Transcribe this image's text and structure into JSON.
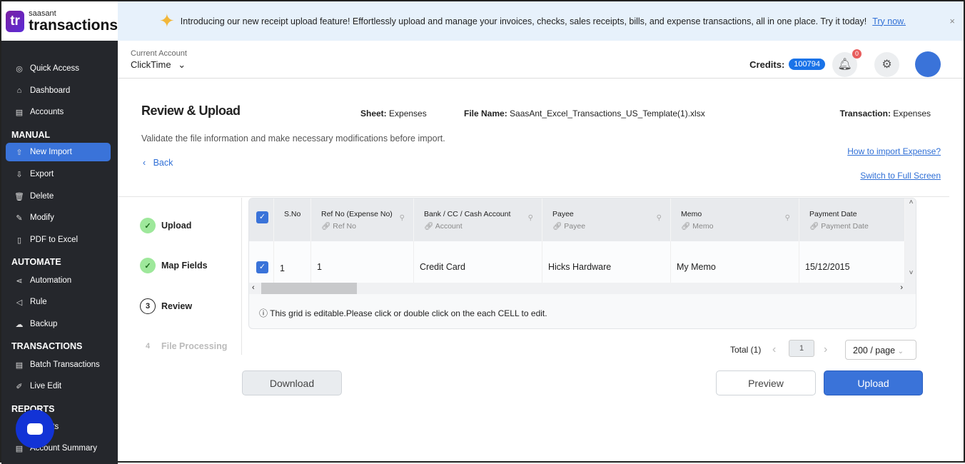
{
  "logo": {
    "small": "saasant",
    "big": "transactions",
    "mark": "tr"
  },
  "banner": {
    "text": "Introducing our new receipt upload feature! Effortlessly upload and manage your invoices, checks, sales receipts, bills, and expense transactions, all in one place. Try it today!",
    "link": "Try now.",
    "close": "×"
  },
  "sidebar": {
    "items": [
      {
        "label": "Quick Access",
        "icon": "target-icon"
      },
      {
        "label": "Dashboard",
        "icon": "home-icon"
      },
      {
        "label": "Accounts",
        "icon": "clipboard-icon"
      },
      {
        "label": "New Import",
        "icon": "upload-cloud-icon",
        "active": true
      },
      {
        "label": "Export",
        "icon": "download-cloud-icon"
      },
      {
        "label": "Delete",
        "icon": "trash-icon"
      },
      {
        "label": "Modify",
        "icon": "edit-file-icon"
      },
      {
        "label": "PDF to Excel",
        "icon": "pdf-icon"
      },
      {
        "label": "Automation",
        "icon": "share-icon"
      },
      {
        "label": "Rule",
        "icon": "megaphone-icon"
      },
      {
        "label": "Backup",
        "icon": "cloud-icon"
      },
      {
        "label": "Batch Transactions",
        "icon": "document-icon"
      },
      {
        "label": "Live Edit",
        "icon": "pencil-icon"
      },
      {
        "label": "Reports",
        "icon": "report-icon"
      },
      {
        "label": "Account Summary",
        "icon": "clipboard-icon"
      }
    ],
    "sections": [
      "MANUAL",
      "AUTOMATE",
      "TRANSACTIONS",
      "REPORTS"
    ]
  },
  "header": {
    "current_account_label": "Current Account",
    "account": "ClickTime",
    "credits_label": "Credits:",
    "credits": "100794",
    "notifications": "0"
  },
  "page": {
    "title": "Review & Upload",
    "sheet_label": "Sheet:",
    "sheet": "Expenses",
    "file_label": "File Name:",
    "file": "SaasAnt_Excel_Transactions_US_Template(1).xlsx",
    "txn_label": "Transaction:",
    "txn": "Expenses",
    "subtitle": "Validate the file information and make necessary modifications before import.",
    "back": "Back",
    "how_to": "How to import Expense?",
    "full_screen": "Switch to Full Screen"
  },
  "steps": [
    {
      "label": "Upload",
      "state": "done"
    },
    {
      "label": "Map Fields",
      "state": "done"
    },
    {
      "label": "Review",
      "num": "3",
      "state": "current"
    },
    {
      "label": "File Processing",
      "num": "4",
      "state": "future"
    }
  ],
  "grid": {
    "columns": [
      {
        "title": "S.No"
      },
      {
        "title": "Ref No (Expense No)",
        "mapped": "Ref No"
      },
      {
        "title": "Bank / CC / Cash Account",
        "mapped": "Account"
      },
      {
        "title": "Payee",
        "mapped": "Payee"
      },
      {
        "title": "Memo",
        "mapped": "Memo"
      },
      {
        "title": "Payment Date",
        "mapped": "Payment Date"
      }
    ],
    "rows": [
      [
        "1",
        "1",
        "Credit Card",
        "Hicks Hardware",
        "My Memo",
        "15/12/2015"
      ]
    ],
    "note": "This grid is editable.Please click or double click on the each CELL to edit."
  },
  "pagination": {
    "total": "Total (1)",
    "page": "1",
    "page_size": "200 / page"
  },
  "buttons": {
    "download": "Download",
    "preview": "Preview",
    "upload": "Upload"
  },
  "colors": {
    "accent": "#3a73d9",
    "sidebar": "#25272c",
    "banner": "#e7f1fb"
  }
}
